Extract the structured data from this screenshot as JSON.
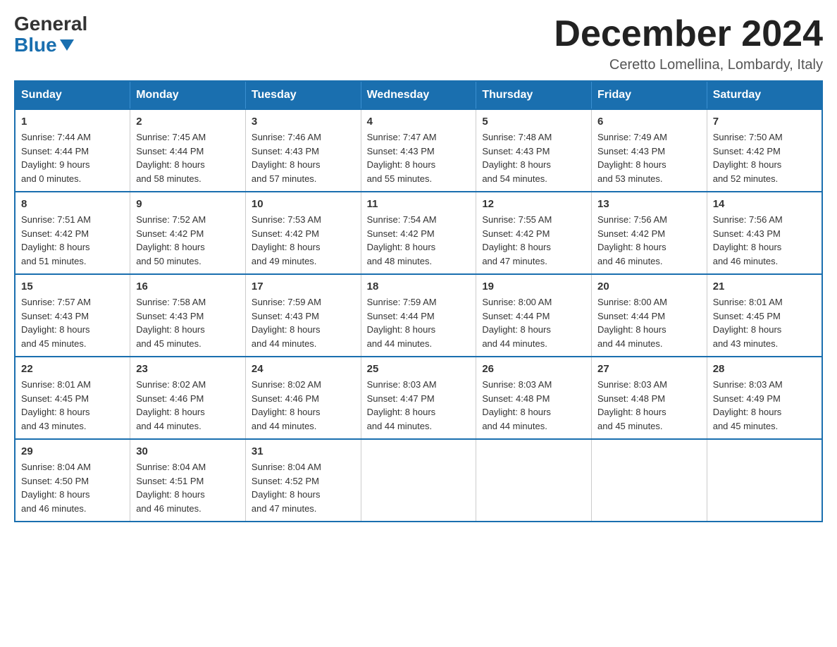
{
  "header": {
    "logo_general": "General",
    "logo_blue": "Blue",
    "month_title": "December 2024",
    "location": "Ceretto Lomellina, Lombardy, Italy"
  },
  "days_of_week": [
    "Sunday",
    "Monday",
    "Tuesday",
    "Wednesday",
    "Thursday",
    "Friday",
    "Saturday"
  ],
  "weeks": [
    [
      {
        "day": "1",
        "sunrise": "7:44 AM",
        "sunset": "4:44 PM",
        "daylight": "9 hours and 0 minutes."
      },
      {
        "day": "2",
        "sunrise": "7:45 AM",
        "sunset": "4:44 PM",
        "daylight": "8 hours and 58 minutes."
      },
      {
        "day": "3",
        "sunrise": "7:46 AM",
        "sunset": "4:43 PM",
        "daylight": "8 hours and 57 minutes."
      },
      {
        "day": "4",
        "sunrise": "7:47 AM",
        "sunset": "4:43 PM",
        "daylight": "8 hours and 55 minutes."
      },
      {
        "day": "5",
        "sunrise": "7:48 AM",
        "sunset": "4:43 PM",
        "daylight": "8 hours and 54 minutes."
      },
      {
        "day": "6",
        "sunrise": "7:49 AM",
        "sunset": "4:43 PM",
        "daylight": "8 hours and 53 minutes."
      },
      {
        "day": "7",
        "sunrise": "7:50 AM",
        "sunset": "4:42 PM",
        "daylight": "8 hours and 52 minutes."
      }
    ],
    [
      {
        "day": "8",
        "sunrise": "7:51 AM",
        "sunset": "4:42 PM",
        "daylight": "8 hours and 51 minutes."
      },
      {
        "day": "9",
        "sunrise": "7:52 AM",
        "sunset": "4:42 PM",
        "daylight": "8 hours and 50 minutes."
      },
      {
        "day": "10",
        "sunrise": "7:53 AM",
        "sunset": "4:42 PM",
        "daylight": "8 hours and 49 minutes."
      },
      {
        "day": "11",
        "sunrise": "7:54 AM",
        "sunset": "4:42 PM",
        "daylight": "8 hours and 48 minutes."
      },
      {
        "day": "12",
        "sunrise": "7:55 AM",
        "sunset": "4:42 PM",
        "daylight": "8 hours and 47 minutes."
      },
      {
        "day": "13",
        "sunrise": "7:56 AM",
        "sunset": "4:42 PM",
        "daylight": "8 hours and 46 minutes."
      },
      {
        "day": "14",
        "sunrise": "7:56 AM",
        "sunset": "4:43 PM",
        "daylight": "8 hours and 46 minutes."
      }
    ],
    [
      {
        "day": "15",
        "sunrise": "7:57 AM",
        "sunset": "4:43 PM",
        "daylight": "8 hours and 45 minutes."
      },
      {
        "day": "16",
        "sunrise": "7:58 AM",
        "sunset": "4:43 PM",
        "daylight": "8 hours and 45 minutes."
      },
      {
        "day": "17",
        "sunrise": "7:59 AM",
        "sunset": "4:43 PM",
        "daylight": "8 hours and 44 minutes."
      },
      {
        "day": "18",
        "sunrise": "7:59 AM",
        "sunset": "4:44 PM",
        "daylight": "8 hours and 44 minutes."
      },
      {
        "day": "19",
        "sunrise": "8:00 AM",
        "sunset": "4:44 PM",
        "daylight": "8 hours and 44 minutes."
      },
      {
        "day": "20",
        "sunrise": "8:00 AM",
        "sunset": "4:44 PM",
        "daylight": "8 hours and 44 minutes."
      },
      {
        "day": "21",
        "sunrise": "8:01 AM",
        "sunset": "4:45 PM",
        "daylight": "8 hours and 43 minutes."
      }
    ],
    [
      {
        "day": "22",
        "sunrise": "8:01 AM",
        "sunset": "4:45 PM",
        "daylight": "8 hours and 43 minutes."
      },
      {
        "day": "23",
        "sunrise": "8:02 AM",
        "sunset": "4:46 PM",
        "daylight": "8 hours and 44 minutes."
      },
      {
        "day": "24",
        "sunrise": "8:02 AM",
        "sunset": "4:46 PM",
        "daylight": "8 hours and 44 minutes."
      },
      {
        "day": "25",
        "sunrise": "8:03 AM",
        "sunset": "4:47 PM",
        "daylight": "8 hours and 44 minutes."
      },
      {
        "day": "26",
        "sunrise": "8:03 AM",
        "sunset": "4:48 PM",
        "daylight": "8 hours and 44 minutes."
      },
      {
        "day": "27",
        "sunrise": "8:03 AM",
        "sunset": "4:48 PM",
        "daylight": "8 hours and 45 minutes."
      },
      {
        "day": "28",
        "sunrise": "8:03 AM",
        "sunset": "4:49 PM",
        "daylight": "8 hours and 45 minutes."
      }
    ],
    [
      {
        "day": "29",
        "sunrise": "8:04 AM",
        "sunset": "4:50 PM",
        "daylight": "8 hours and 46 minutes."
      },
      {
        "day": "30",
        "sunrise": "8:04 AM",
        "sunset": "4:51 PM",
        "daylight": "8 hours and 46 minutes."
      },
      {
        "day": "31",
        "sunrise": "8:04 AM",
        "sunset": "4:52 PM",
        "daylight": "8 hours and 47 minutes."
      },
      null,
      null,
      null,
      null
    ]
  ]
}
